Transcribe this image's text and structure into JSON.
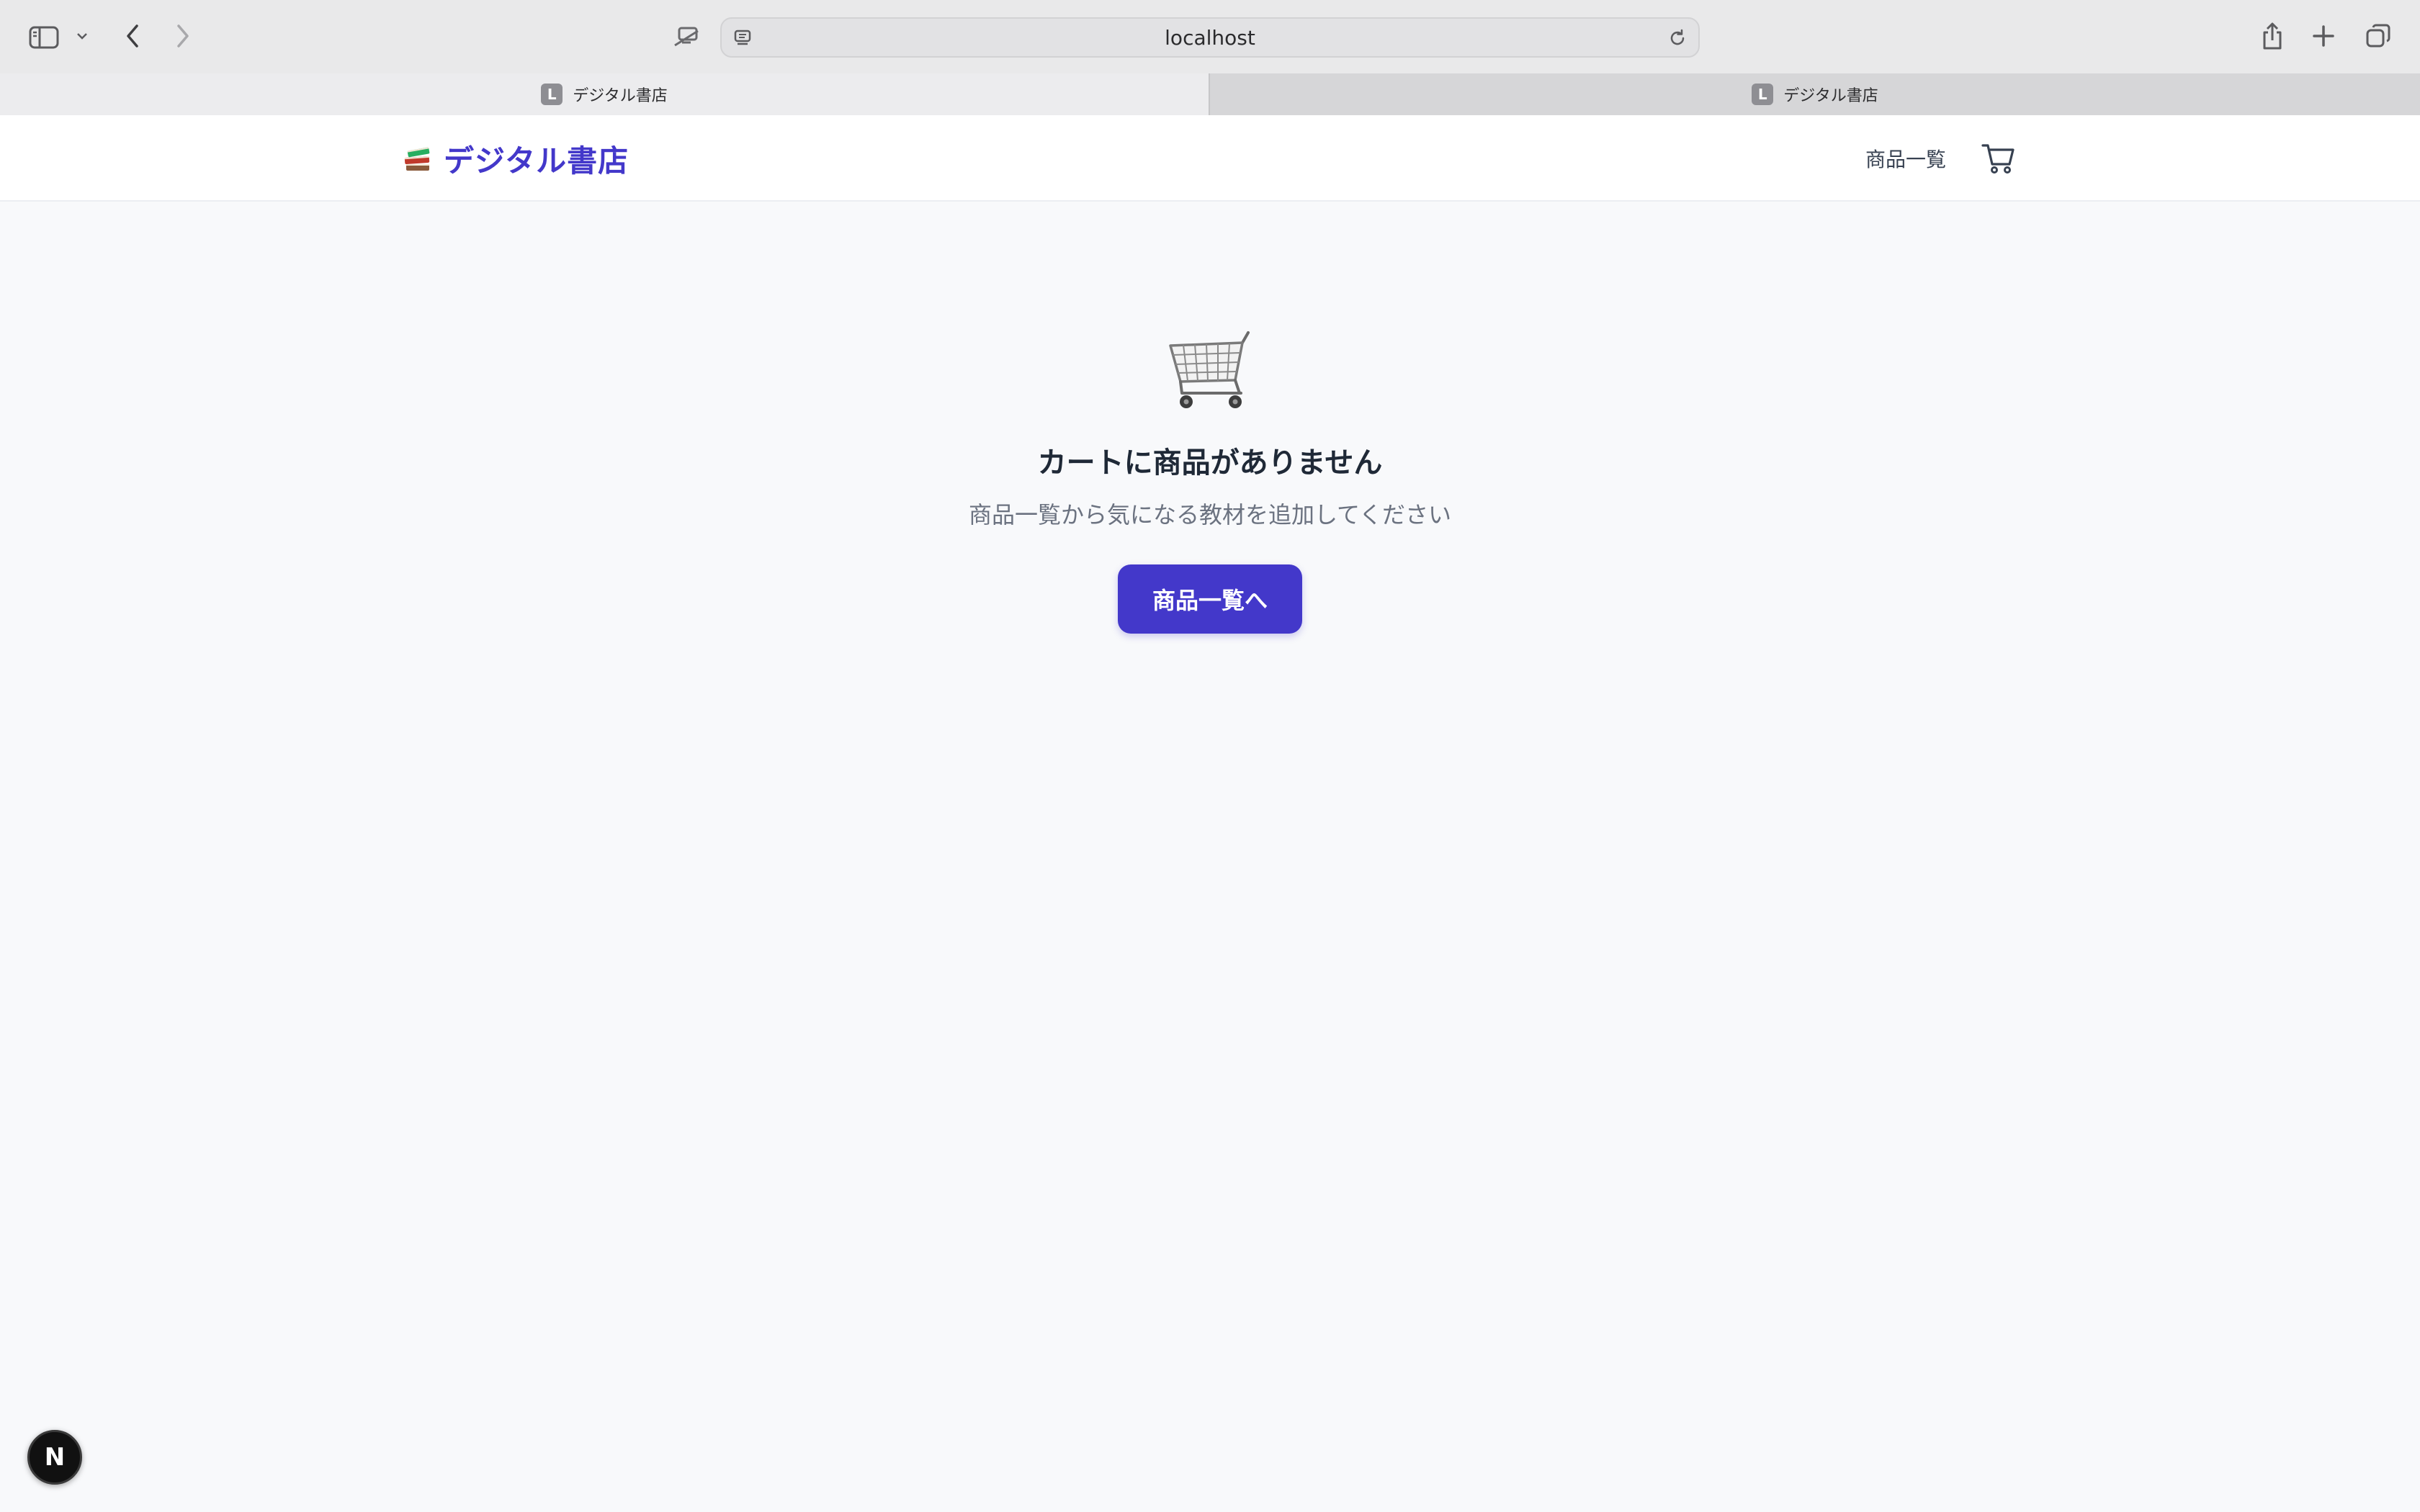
{
  "browser": {
    "url": "localhost",
    "tabs": [
      {
        "label": "デジタル書店",
        "favicon": "L"
      },
      {
        "label": "デジタル書店",
        "favicon": "L"
      }
    ]
  },
  "header": {
    "logo_text": "デジタル書店",
    "logo_icon": "books-emoji",
    "nav_products": "商品一覧",
    "cart_icon": "cart-icon"
  },
  "empty_cart": {
    "illustration": "shopping-cart-emoji",
    "title": "カートに商品がありません",
    "subtitle": "商品一覧から気になる教材を追加してください",
    "cta_label": "商品一覧へ"
  },
  "dev_badge": {
    "label": "N"
  },
  "colors": {
    "brand": "#4338ca",
    "page_bg": "#f8f9fb",
    "title_text": "#1f2937",
    "muted_text": "#6b7280"
  }
}
